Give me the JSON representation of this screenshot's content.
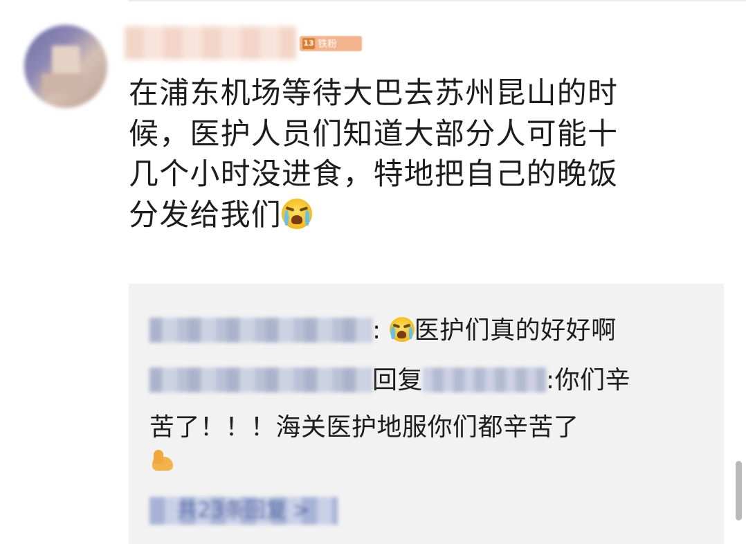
{
  "comment": {
    "author_badge_text": "铁粉",
    "badge_icon_text": "13",
    "text": "在浦东机场等待大巴去苏州昆山的时候，医护人员们知道大部分人可能十几个小时没进食，特地把自己的晚饭分发给我们",
    "line1": "在浦东机场等待大巴去苏州昆山的时",
    "line2": "候，医护人员们知道大部分人可能十",
    "line3": "几个小时没进食，特地把自己的晚饭",
    "line4": "分发给我们",
    "emoji": "crying-face"
  },
  "replies": [
    {
      "separator": ":",
      "emoji": "crying-face",
      "text": "医护们真的好好啊"
    },
    {
      "action": "回复",
      "text_line1": ":你们辛",
      "text_line2": "苦了！！！海关医护地服你们都辛苦了",
      "emoji": "flexed-biceps"
    }
  ],
  "more_replies_label": "共23条回复 >",
  "colors": {
    "background": "#ffffff",
    "reply_box": "#f2f2f2",
    "link_blue": "#5d6ea8",
    "text": "#1d1d1d"
  }
}
